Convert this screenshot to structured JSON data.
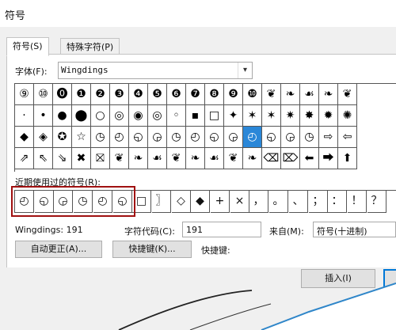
{
  "window": {
    "title": "符号"
  },
  "tabs": [
    {
      "label": "符号(S)"
    },
    {
      "label": "特殊字符(P)"
    }
  ],
  "font": {
    "label": "字体(F):",
    "value": "Wingdings"
  },
  "symbol_grid": {
    "rows": [
      [
        "⑨",
        "⑩",
        "⓿",
        "❶",
        "❷",
        "❸",
        "❹",
        "❺",
        "❻",
        "❼",
        "❽",
        "❾",
        "❿",
        "❦",
        "❧",
        "☙",
        "❧",
        "❦"
      ],
      [
        "·",
        "•",
        "●",
        "⬤",
        "○",
        "◎",
        "◉",
        "◎",
        "◦",
        "▪",
        "□",
        "✦",
        "✶",
        "✶",
        "✷",
        "✸",
        "✹",
        "✺"
      ],
      [
        "◆",
        "◈",
        "✪",
        "☆",
        "◷",
        "◴",
        "◵",
        "◶",
        "◷",
        "◴",
        "◵",
        "◶",
        "◴",
        "◵",
        "◶",
        "◷",
        "⇨",
        "⇦"
      ],
      [
        "⇗",
        "⇖",
        "⇘",
        "✖",
        "⛝",
        "❦",
        "❧",
        "☙",
        "❦",
        "❧",
        "☙",
        "❦",
        "❧",
        "⌫",
        "⌦",
        "⬅",
        "⮕",
        "⬆"
      ]
    ],
    "selected": {
      "row": 2,
      "col": 12
    }
  },
  "recent": {
    "label": "近期使用过的符号(R):",
    "items": [
      "◴",
      "◵",
      "◶",
      "◷",
      "◴",
      "◵",
      "□",
      "〗",
      "◇",
      "◆",
      "+",
      "×",
      "，",
      "。",
      "、",
      "；",
      "：",
      "！",
      "？"
    ]
  },
  "info": {
    "font_code_text": "Wingdings: 191",
    "char_code_label": "字符代码(C):",
    "char_code_value": "191",
    "from_label": "来自(M):",
    "from_value": "符号(十进制)"
  },
  "buttons": {
    "autocorrect": "自动更正(A)...",
    "shortcut_key": "快捷键(K)...",
    "shortcut_label": "快捷键:",
    "insert": "插入(I)"
  },
  "colors": {
    "selection": "#2a87d8",
    "highlight_box": "#a01010",
    "accent": "#0078d7"
  }
}
